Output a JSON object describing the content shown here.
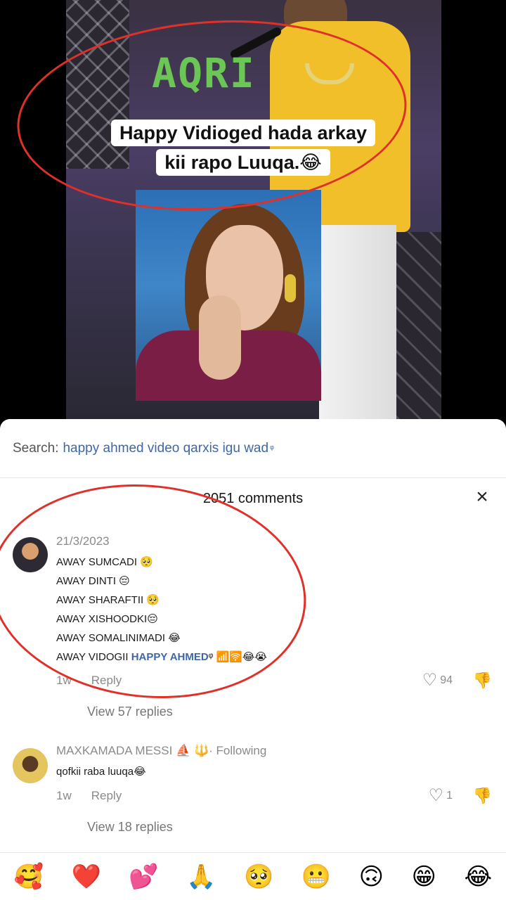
{
  "video": {
    "overlay_title": "AQRI",
    "caption_line1": "Happy Vidioged hada arkay",
    "caption_line2": "kii rapo Luuqa.😂"
  },
  "search": {
    "label": "Search:",
    "query": "happy ahmed video qarxis igu wad",
    "mark": "ᵠ"
  },
  "comments_header": {
    "count_text": "2051 comments",
    "close_icon": "×"
  },
  "comments": [
    {
      "author": "21/3/2023",
      "lines": [
        "AWAY SUMCADI 🥺",
        "AWAY DINTI 😔",
        "AWAY SHARAFTII 🥺",
        "AWAY XISHOODKI😔",
        "AWAY SOMALINIMADI 😂"
      ],
      "last_line_prefix": "AWAY VIDOGII ",
      "last_line_link": "HAPPY AHMED",
      "last_line_suffix": "ᵠ 📶🛜😂😭",
      "time": "1w",
      "reply_label": "Reply",
      "likes": "94",
      "view_replies": "View 57 replies"
    },
    {
      "author": "MAXKAMADA MESSI",
      "author_badges": "⛵ 🔱·",
      "following": "Following",
      "text": "qofkii raba luuqa😂",
      "time": "1w",
      "reply_label": "Reply",
      "likes": "1",
      "view_replies": "View 18 replies"
    }
  ],
  "emoji_bar": [
    "🥰",
    "❤️",
    "💕",
    "🙏",
    "🥺",
    "😬",
    "🙃",
    "😁",
    "😂"
  ],
  "icons": {
    "heart": "♡",
    "dislike": "👎"
  }
}
